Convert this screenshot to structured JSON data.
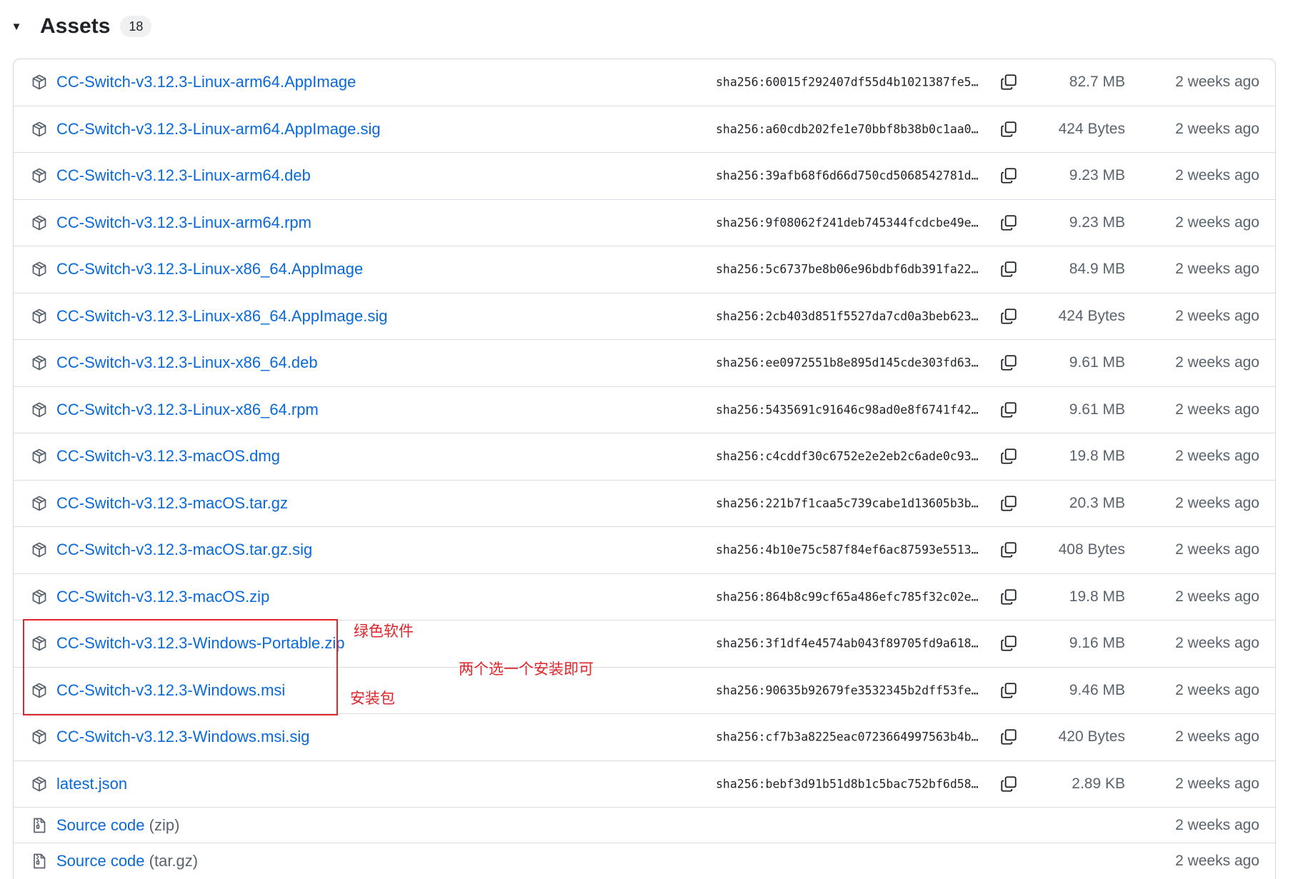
{
  "header": {
    "title": "Assets",
    "count": "18",
    "toggle": "▼"
  },
  "assets": [
    {
      "name": "CC-Switch-v3.12.3-Linux-arm64.AppImage",
      "hash": "sha256:60015f292407df55d4b1021387fe5…",
      "size": "82.7 MB",
      "time": "2 weeks ago"
    },
    {
      "name": "CC-Switch-v3.12.3-Linux-arm64.AppImage.sig",
      "hash": "sha256:a60cdb202fe1e70bbf8b38b0c1aa0…",
      "size": "424 Bytes",
      "time": "2 weeks ago"
    },
    {
      "name": "CC-Switch-v3.12.3-Linux-arm64.deb",
      "hash": "sha256:39afb68f6d66d750cd5068542781d…",
      "size": "9.23 MB",
      "time": "2 weeks ago"
    },
    {
      "name": "CC-Switch-v3.12.3-Linux-arm64.rpm",
      "hash": "sha256:9f08062f241deb745344fcdcbe49e…",
      "size": "9.23 MB",
      "time": "2 weeks ago"
    },
    {
      "name": "CC-Switch-v3.12.3-Linux-x86_64.AppImage",
      "hash": "sha256:5c6737be8b06e96bdbf6db391fa22…",
      "size": "84.9 MB",
      "time": "2 weeks ago"
    },
    {
      "name": "CC-Switch-v3.12.3-Linux-x86_64.AppImage.sig",
      "hash": "sha256:2cb403d851f5527da7cd0a3beb623…",
      "size": "424 Bytes",
      "time": "2 weeks ago"
    },
    {
      "name": "CC-Switch-v3.12.3-Linux-x86_64.deb",
      "hash": "sha256:ee0972551b8e895d145cde303fd63…",
      "size": "9.61 MB",
      "time": "2 weeks ago"
    },
    {
      "name": "CC-Switch-v3.12.3-Linux-x86_64.rpm",
      "hash": "sha256:5435691c91646c98ad0e8f6741f42…",
      "size": "9.61 MB",
      "time": "2 weeks ago"
    },
    {
      "name": "CC-Switch-v3.12.3-macOS.dmg",
      "hash": "sha256:c4cddf30c6752e2e2eb2c6ade0c93…",
      "size": "19.8 MB",
      "time": "2 weeks ago"
    },
    {
      "name": "CC-Switch-v3.12.3-macOS.tar.gz",
      "hash": "sha256:221b7f1caa5c739cabe1d13605b3b…",
      "size": "20.3 MB",
      "time": "2 weeks ago"
    },
    {
      "name": "CC-Switch-v3.12.3-macOS.tar.gz.sig",
      "hash": "sha256:4b10e75c587f84ef6ac87593e5513…",
      "size": "408 Bytes",
      "time": "2 weeks ago"
    },
    {
      "name": "CC-Switch-v3.12.3-macOS.zip",
      "hash": "sha256:864b8c99cf65a486efc785f32c02e…",
      "size": "19.8 MB",
      "time": "2 weeks ago"
    },
    {
      "name": "CC-Switch-v3.12.3-Windows-Portable.zip",
      "hash": "sha256:3f1df4e4574ab043f89705fd9a618…",
      "size": "9.16 MB",
      "time": "2 weeks ago"
    },
    {
      "name": "CC-Switch-v3.12.3-Windows.msi",
      "hash": "sha256:90635b92679fe3532345b2dff53fe…",
      "size": "9.46 MB",
      "time": "2 weeks ago"
    },
    {
      "name": "CC-Switch-v3.12.3-Windows.msi.sig",
      "hash": "sha256:cf7b3a8225eac0723664997563b4b…",
      "size": "420 Bytes",
      "time": "2 weeks ago"
    },
    {
      "name": "latest.json",
      "hash": "sha256:bebf3d91b51d8b1c5bac752bf6d58…",
      "size": "2.89 KB",
      "time": "2 weeks ago"
    }
  ],
  "sources": [
    {
      "label": "Source code",
      "ext": "(zip)",
      "time": "2 weeks ago"
    },
    {
      "label": "Source code",
      "ext": "(tar.gz)",
      "time": "2 weeks ago"
    }
  ],
  "annotations": {
    "portable": "绿色软件",
    "installer": "安装包",
    "choose": "两个选一个安装即可",
    "color": "#e0252a"
  },
  "icons": {
    "asset": "package-icon",
    "source": "file-zip-icon",
    "copy": "copy-icon"
  },
  "colors": {
    "link": "#0969da",
    "muted": "#59636e",
    "border": "#d0d7de"
  }
}
